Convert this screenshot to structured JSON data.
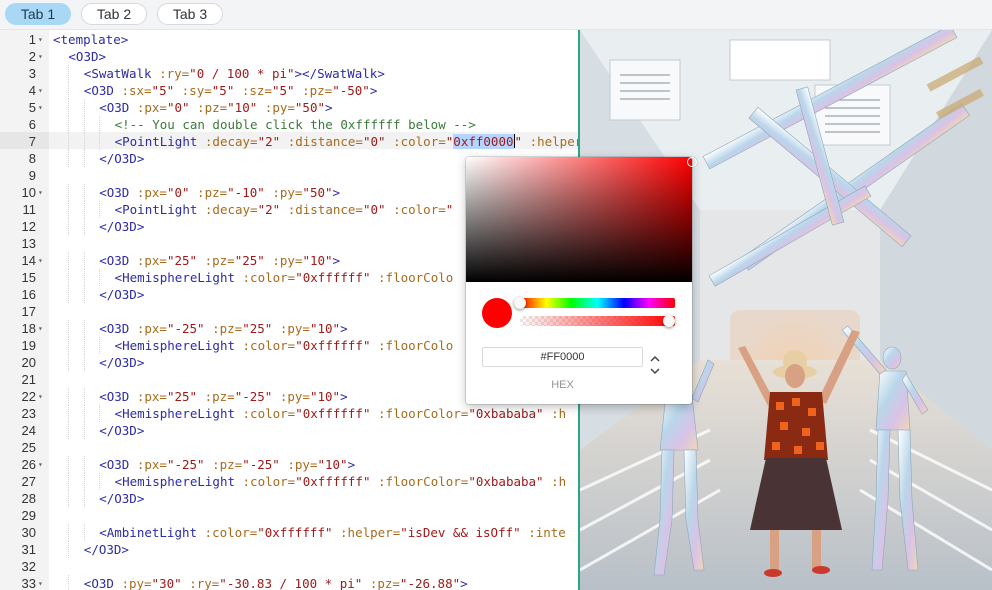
{
  "tabs": [
    {
      "label": "Tab 1",
      "active": true
    },
    {
      "label": "Tab 2",
      "active": false
    },
    {
      "label": "Tab 3",
      "active": false
    }
  ],
  "editor": {
    "active_line": 7,
    "lines": [
      {
        "n": "1",
        "fold": true,
        "indent": 0,
        "tokens": [
          [
            "tag",
            "<template>"
          ]
        ]
      },
      {
        "n": "2",
        "fold": true,
        "indent": 1,
        "tokens": [
          [
            "tag",
            "<O3D>"
          ]
        ]
      },
      {
        "n": "3",
        "fold": false,
        "indent": 2,
        "tokens": [
          [
            "tag",
            "<SwatWalk "
          ],
          [
            "attr",
            ":ry="
          ],
          [
            "str",
            "\"0 / 100 * pi\""
          ],
          [
            "tag",
            "></SwatWalk>"
          ]
        ]
      },
      {
        "n": "4",
        "fold": true,
        "indent": 2,
        "tokens": [
          [
            "tag",
            "<O3D "
          ],
          [
            "attr",
            ":sx="
          ],
          [
            "str",
            "\"5\" "
          ],
          [
            "attr",
            ":sy="
          ],
          [
            "str",
            "\"5\" "
          ],
          [
            "attr",
            ":sz="
          ],
          [
            "str",
            "\"5\" "
          ],
          [
            "attr",
            ":pz="
          ],
          [
            "str",
            "\"-50\""
          ],
          [
            "tag",
            ">"
          ]
        ]
      },
      {
        "n": "5",
        "fold": true,
        "indent": 3,
        "tokens": [
          [
            "tag",
            "<O3D "
          ],
          [
            "attr",
            ":px="
          ],
          [
            "str",
            "\"0\" "
          ],
          [
            "attr",
            ":pz="
          ],
          [
            "str",
            "\"10\" "
          ],
          [
            "attr",
            ":py="
          ],
          [
            "str",
            "\"50\""
          ],
          [
            "tag",
            ">"
          ]
        ]
      },
      {
        "n": "6",
        "fold": false,
        "indent": 4,
        "tokens": [
          [
            "cmt",
            "<!-- You can double click the 0xffffff below -->"
          ]
        ]
      },
      {
        "n": "7",
        "fold": false,
        "indent": 4,
        "tokens": [
          [
            "tag",
            "<PointLight "
          ],
          [
            "attr",
            ":decay="
          ],
          [
            "str",
            "\"2\" "
          ],
          [
            "attr",
            ":distance="
          ],
          [
            "str",
            "\"0\" "
          ],
          [
            "attr",
            ":color="
          ],
          [
            "str",
            "\""
          ],
          [
            "sel",
            "0xff0000"
          ],
          [
            "cursor",
            ""
          ],
          [
            "str",
            "\" "
          ],
          [
            "attr",
            ":helper"
          ]
        ]
      },
      {
        "n": "8",
        "fold": false,
        "indent": 3,
        "tokens": [
          [
            "tag",
            "</O3D>"
          ]
        ]
      },
      {
        "n": "9",
        "fold": false,
        "indent": 0,
        "tokens": []
      },
      {
        "n": "10",
        "fold": true,
        "indent": 3,
        "tokens": [
          [
            "tag",
            "<O3D "
          ],
          [
            "attr",
            ":px="
          ],
          [
            "str",
            "\"0\" "
          ],
          [
            "attr",
            ":pz="
          ],
          [
            "str",
            "\"-10\" "
          ],
          [
            "attr",
            ":py="
          ],
          [
            "str",
            "\"50\""
          ],
          [
            "tag",
            ">"
          ]
        ]
      },
      {
        "n": "11",
        "fold": false,
        "indent": 4,
        "tokens": [
          [
            "tag",
            "<PointLight "
          ],
          [
            "attr",
            ":decay="
          ],
          [
            "str",
            "\"2\" "
          ],
          [
            "attr",
            ":distance="
          ],
          [
            "str",
            "\"0\" "
          ],
          [
            "attr",
            ":color="
          ],
          [
            "str",
            "\""
          ]
        ]
      },
      {
        "n": "12",
        "fold": false,
        "indent": 3,
        "tokens": [
          [
            "tag",
            "</O3D>"
          ]
        ]
      },
      {
        "n": "13",
        "fold": false,
        "indent": 0,
        "tokens": []
      },
      {
        "n": "14",
        "fold": true,
        "indent": 3,
        "tokens": [
          [
            "tag",
            "<O3D "
          ],
          [
            "attr",
            ":px="
          ],
          [
            "str",
            "\"25\" "
          ],
          [
            "attr",
            ":pz="
          ],
          [
            "str",
            "\"25\" "
          ],
          [
            "attr",
            ":py="
          ],
          [
            "str",
            "\"10\""
          ],
          [
            "tag",
            ">"
          ]
        ]
      },
      {
        "n": "15",
        "fold": false,
        "indent": 4,
        "tokens": [
          [
            "tag",
            "<HemisphereLight "
          ],
          [
            "attr",
            ":color="
          ],
          [
            "str",
            "\"0xffffff\" "
          ],
          [
            "attr",
            ":floorColo"
          ]
        ]
      },
      {
        "n": "16",
        "fold": false,
        "indent": 3,
        "tokens": [
          [
            "tag",
            "</O3D>"
          ]
        ]
      },
      {
        "n": "17",
        "fold": false,
        "indent": 0,
        "tokens": []
      },
      {
        "n": "18",
        "fold": true,
        "indent": 3,
        "tokens": [
          [
            "tag",
            "<O3D "
          ],
          [
            "attr",
            ":px="
          ],
          [
            "str",
            "\"-25\" "
          ],
          [
            "attr",
            ":pz="
          ],
          [
            "str",
            "\"25\" "
          ],
          [
            "attr",
            ":py="
          ],
          [
            "str",
            "\"10\""
          ],
          [
            "tag",
            ">"
          ]
        ]
      },
      {
        "n": "19",
        "fold": false,
        "indent": 4,
        "tokens": [
          [
            "tag",
            "<HemisphereLight "
          ],
          [
            "attr",
            ":color="
          ],
          [
            "str",
            "\"0xffffff\" "
          ],
          [
            "attr",
            ":floorColo"
          ]
        ]
      },
      {
        "n": "20",
        "fold": false,
        "indent": 3,
        "tokens": [
          [
            "tag",
            "</O3D>"
          ]
        ]
      },
      {
        "n": "21",
        "fold": false,
        "indent": 0,
        "tokens": []
      },
      {
        "n": "22",
        "fold": true,
        "indent": 3,
        "tokens": [
          [
            "tag",
            "<O3D "
          ],
          [
            "attr",
            ":px="
          ],
          [
            "str",
            "\"25\" "
          ],
          [
            "attr",
            ":pz="
          ],
          [
            "str",
            "\"-25\" "
          ],
          [
            "attr",
            ":py="
          ],
          [
            "str",
            "\"10\""
          ],
          [
            "tag",
            ">"
          ]
        ]
      },
      {
        "n": "23",
        "fold": false,
        "indent": 4,
        "tokens": [
          [
            "tag",
            "<HemisphereLight "
          ],
          [
            "attr",
            ":color="
          ],
          [
            "str",
            "\"0xffffff\" "
          ],
          [
            "attr",
            ":floorColor="
          ],
          [
            "str",
            "\"0xbababa\" "
          ],
          [
            "attr",
            ":h"
          ]
        ]
      },
      {
        "n": "24",
        "fold": false,
        "indent": 3,
        "tokens": [
          [
            "tag",
            "</O3D>"
          ]
        ]
      },
      {
        "n": "25",
        "fold": false,
        "indent": 0,
        "tokens": []
      },
      {
        "n": "26",
        "fold": true,
        "indent": 3,
        "tokens": [
          [
            "tag",
            "<O3D "
          ],
          [
            "attr",
            ":px="
          ],
          [
            "str",
            "\"-25\" "
          ],
          [
            "attr",
            ":pz="
          ],
          [
            "str",
            "\"-25\" "
          ],
          [
            "attr",
            ":py="
          ],
          [
            "str",
            "\"10\""
          ],
          [
            "tag",
            ">"
          ]
        ]
      },
      {
        "n": "27",
        "fold": false,
        "indent": 4,
        "tokens": [
          [
            "tag",
            "<HemisphereLight "
          ],
          [
            "attr",
            ":color="
          ],
          [
            "str",
            "\"0xffffff\" "
          ],
          [
            "attr",
            ":floorColor="
          ],
          [
            "str",
            "\"0xbababa\" "
          ],
          [
            "attr",
            ":h"
          ]
        ]
      },
      {
        "n": "28",
        "fold": false,
        "indent": 3,
        "tokens": [
          [
            "tag",
            "</O3D>"
          ]
        ]
      },
      {
        "n": "29",
        "fold": false,
        "indent": 0,
        "tokens": []
      },
      {
        "n": "30",
        "fold": false,
        "indent": 3,
        "tokens": [
          [
            "tag",
            "<AmbinetLight "
          ],
          [
            "attr",
            ":color="
          ],
          [
            "str",
            "\"0xffffff\" "
          ],
          [
            "attr",
            ":helper="
          ],
          [
            "str",
            "\"isDev && isOff\" "
          ],
          [
            "attr",
            ":inte"
          ]
        ]
      },
      {
        "n": "31",
        "fold": false,
        "indent": 2,
        "tokens": [
          [
            "tag",
            "</O3D>"
          ]
        ]
      },
      {
        "n": "32",
        "fold": false,
        "indent": 0,
        "tokens": []
      },
      {
        "n": "33",
        "fold": true,
        "indent": 2,
        "tokens": [
          [
            "tag",
            "<O3D "
          ],
          [
            "attr",
            ":py="
          ],
          [
            "str",
            "\"30\" "
          ],
          [
            "attr",
            ":ry="
          ],
          [
            "str",
            "\"-30.83 / 100 * pi\" "
          ],
          [
            "attr",
            ":pz="
          ],
          [
            "str",
            "\"-26.88\""
          ],
          [
            "tag",
            ">"
          ]
        ]
      }
    ]
  },
  "color_picker": {
    "hex_value": "#FF0000",
    "mode_label": "HEX",
    "current_color": "#ff0000",
    "hue_level": 0,
    "alpha_level": 1.0
  },
  "colors": {
    "tab_active": "#a9d8f7",
    "splitter": "#2aa58a",
    "tag": "#2c2ca6",
    "attr": "#a86b1d",
    "string": "#a01a1a",
    "comment": "#3b7a3b"
  },
  "icons": {
    "fold": "caret-down-icon",
    "mode_toggle": "up-down-chevron-icon"
  }
}
